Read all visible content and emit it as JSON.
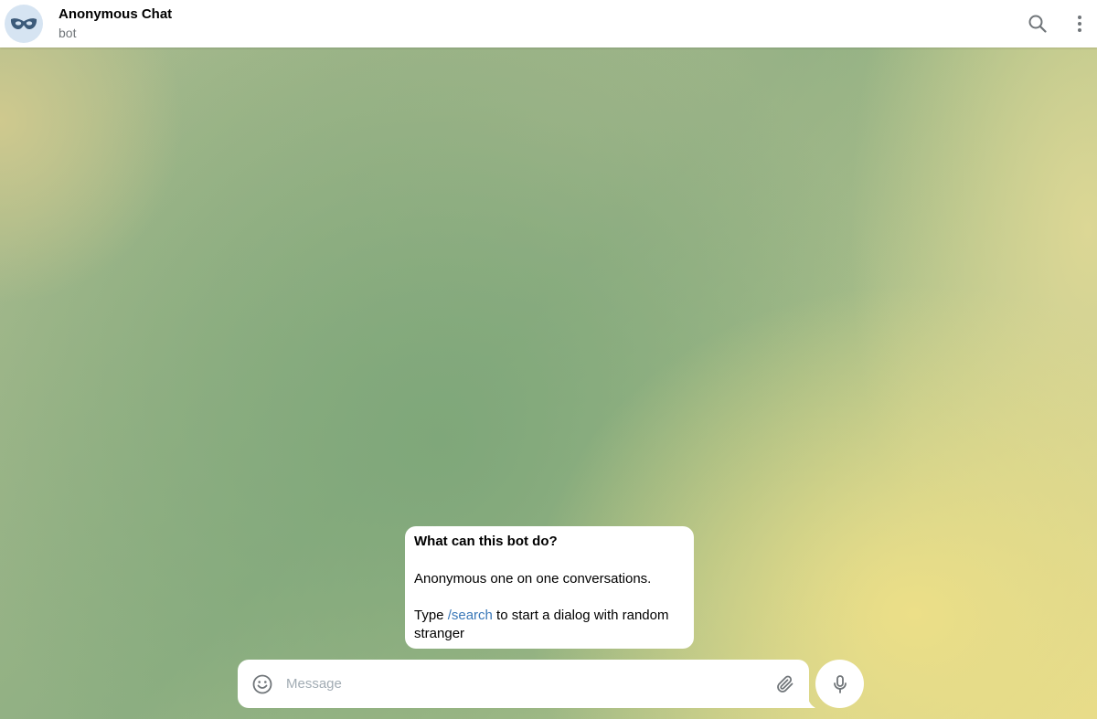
{
  "header": {
    "title": "Anonymous Chat",
    "subtitle": "bot",
    "avatar_icon": "mask-icon",
    "actions": [
      "search-icon",
      "more-vertical-icon"
    ]
  },
  "bot_info": {
    "title": "What can this bot do?",
    "line1": "Anonymous one on one conversations.",
    "line2_prefix": "Type ",
    "line2_command": "/search",
    "line2_suffix": " to start a dialog with random stranger"
  },
  "composer": {
    "placeholder": "Message",
    "value": "",
    "icons": [
      "smile-icon",
      "paperclip-icon",
      "microphone-icon"
    ]
  },
  "colors": {
    "link": "#3a78b8",
    "icon": "#707579",
    "placeholder": "#a2acb4",
    "avatar_bg": "#d6e4f2"
  }
}
